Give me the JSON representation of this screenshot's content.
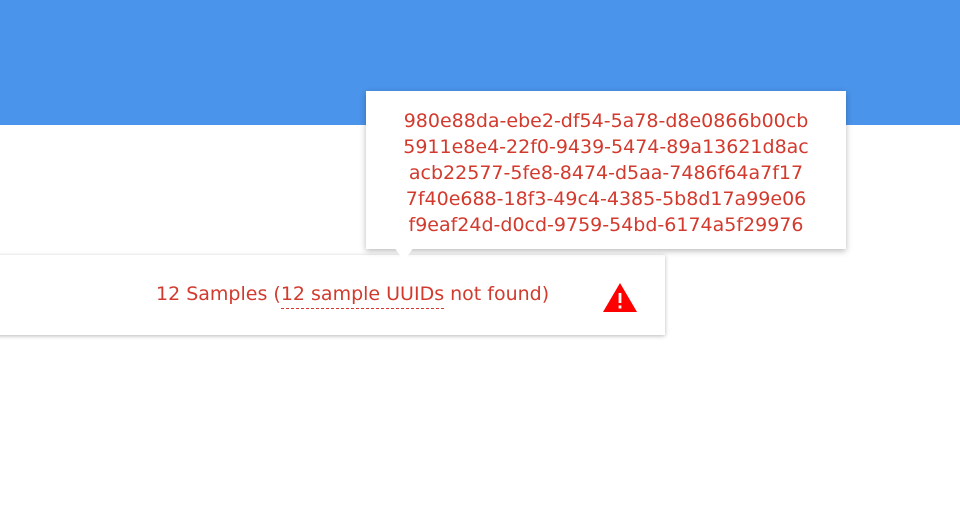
{
  "summary": {
    "prefix": "12 Samples (",
    "link_text": "12 sample UUIDs",
    "suffix": " not found)"
  },
  "warning_icon": "warning-icon",
  "tooltip": {
    "uuids": [
      "980e88da-ebe2-df54-5a78-d8e0866b00cb",
      "5911e8e4-22f0-9439-5474-89a13621d8ac",
      "acb22577-5fe8-8474-d5aa-7486f64a7f17",
      "7f40e688-18f3-49c4-4385-5b8d17a99e06",
      "f9eaf24d-d0cd-9759-54bd-6174a5f29976"
    ]
  },
  "colors": {
    "header": "#4a94eb",
    "error_text": "#d23a2e",
    "warning": "#ff0000"
  }
}
